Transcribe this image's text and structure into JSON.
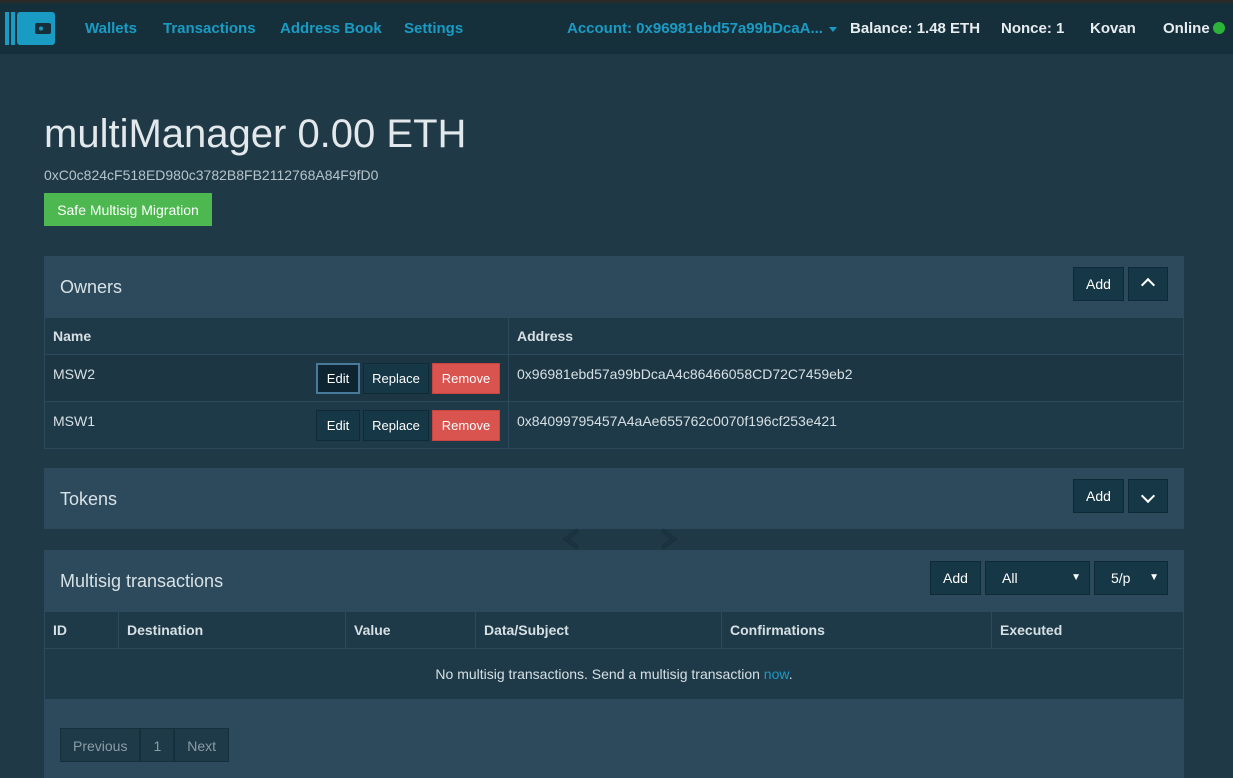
{
  "nav": {
    "wallets": "Wallets",
    "transactions": "Transactions",
    "address_book": "Address Book",
    "settings": "Settings",
    "account": "Account: 0x96981ebd57a99bDcaA...",
    "balance": "Balance: 1.48 ETH",
    "nonce": "Nonce: 1",
    "network": "Kovan",
    "status": "Online"
  },
  "wallet": {
    "title": "multiManager 0.00 ETH",
    "address": "0xC0c824cF518ED980c3782B8FB2112768A84F9fD0",
    "migration_button": "Safe Multisig Migration"
  },
  "owners": {
    "title": "Owners",
    "add_label": "Add",
    "columns": [
      "Name",
      "Address"
    ],
    "rows": [
      {
        "name": "MSW2",
        "address": "0x96981ebd57a99bDcaA4c86466058CD72C7459eb2"
      },
      {
        "name": "MSW1",
        "address": "0x84099795457A4aAe655762c0070f196cf253e421"
      }
    ],
    "edit_label": "Edit",
    "replace_label": "Replace",
    "remove_label": "Remove"
  },
  "tokens": {
    "title": "Tokens",
    "add_label": "Add"
  },
  "multisig": {
    "title": "Multisig transactions",
    "add_label": "Add",
    "filter_value": "All",
    "page_size_value": "5/p",
    "columns": [
      "ID",
      "Destination",
      "Value",
      "Data/Subject",
      "Confirmations",
      "Executed"
    ],
    "empty_text": "No multisig transactions. Send a multisig transaction ",
    "empty_link": "now",
    "empty_suffix": "."
  },
  "pagination": {
    "previous": "Previous",
    "page": "1",
    "next": "Next"
  },
  "colors": {
    "background": "#1f3a46",
    "topbar": "#16303b",
    "link": "#1a9bc4",
    "success": "#4cb84f",
    "danger": "#d9534f",
    "online": "#2bb33a"
  }
}
